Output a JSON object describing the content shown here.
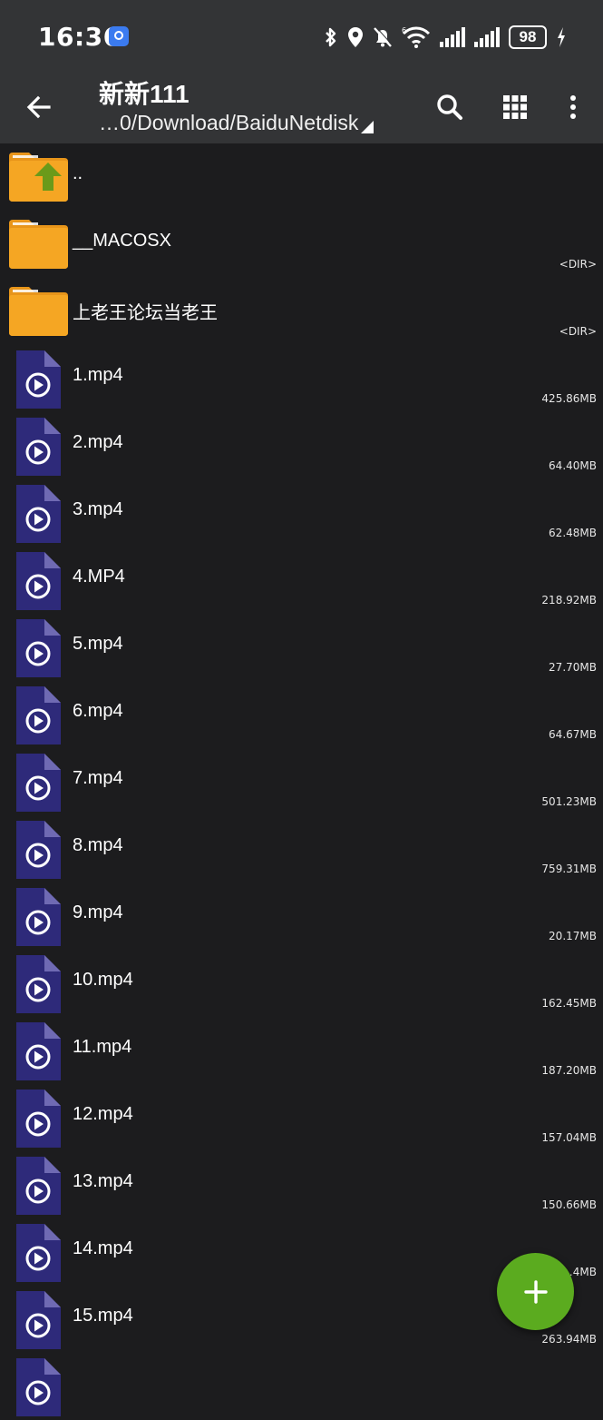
{
  "status_bar": {
    "time": "16:36",
    "battery": "98",
    "icons": [
      "app-notification-icon",
      "bluetooth-icon",
      "location-icon",
      "mute-icon",
      "wifi-6-icon",
      "signal-icon",
      "signal-icon",
      "charging-icon"
    ]
  },
  "toolbar": {
    "title": "新新111",
    "path": "…0/Download/BaiduNetdisk",
    "icons": [
      "back-arrow-icon",
      "search-icon",
      "grid-view-icon",
      "more-icon"
    ]
  },
  "rows": [
    {
      "type": "parent",
      "name": "..",
      "meta": ""
    },
    {
      "type": "folder",
      "name": "__MACOSX",
      "meta": "<DIR>"
    },
    {
      "type": "folder",
      "name": "上老王论坛当老王",
      "meta": "<DIR>"
    },
    {
      "type": "video",
      "name": "1.mp4",
      "meta": "425.86MB"
    },
    {
      "type": "video",
      "name": "2.mp4",
      "meta": "64.40MB"
    },
    {
      "type": "video",
      "name": "3.mp4",
      "meta": "62.48MB"
    },
    {
      "type": "video",
      "name": "4.MP4",
      "meta": "218.92MB"
    },
    {
      "type": "video",
      "name": "5.mp4",
      "meta": "27.70MB"
    },
    {
      "type": "video",
      "name": "6.mp4",
      "meta": "64.67MB"
    },
    {
      "type": "video",
      "name": "7.mp4",
      "meta": "501.23MB"
    },
    {
      "type": "video",
      "name": "8.mp4",
      "meta": "759.31MB"
    },
    {
      "type": "video",
      "name": "9.mp4",
      "meta": "20.17MB"
    },
    {
      "type": "video",
      "name": "10.mp4",
      "meta": "162.45MB"
    },
    {
      "type": "video",
      "name": "11.mp4",
      "meta": "187.20MB"
    },
    {
      "type": "video",
      "name": "12.mp4",
      "meta": "157.04MB"
    },
    {
      "type": "video",
      "name": "13.mp4",
      "meta": "150.66MB"
    },
    {
      "type": "video",
      "name": "14.mp4",
      "meta": "…4MB"
    },
    {
      "type": "video",
      "name": "15.mp4",
      "meta": "263.94MB"
    },
    {
      "type": "video",
      "name": "",
      "meta": ""
    }
  ],
  "fab": {
    "icon": "plus-icon"
  },
  "colors": {
    "background": "#1c1c1e",
    "toolbar": "#333436",
    "folder": "#f5a623",
    "video_icon": "#2e2a7a",
    "fab": "#5bab1f",
    "up_arrow": "#6a9a1a"
  }
}
